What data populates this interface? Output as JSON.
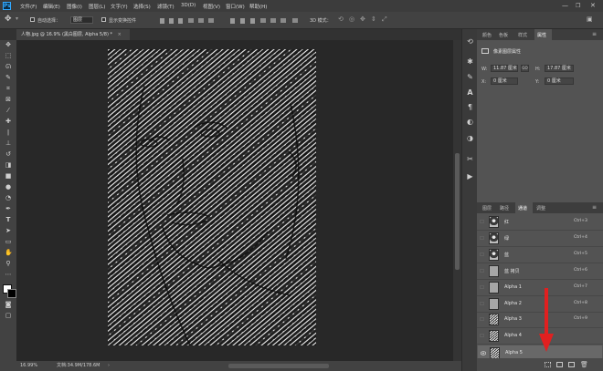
{
  "app": {
    "logo": "Ps",
    "accent": "#31a8ff"
  },
  "menu": [
    "文件(F)",
    "编辑(E)",
    "图像(I)",
    "图层(L)",
    "文字(Y)",
    "选择(S)",
    "滤镜(T)",
    "3D(D)",
    "视图(V)",
    "窗口(W)",
    "帮助(H)"
  ],
  "options_bar": {
    "auto_select_label": "自动选择：",
    "auto_select_value": "图层",
    "show_transform_label": "显示变换控件",
    "mode_3d_label": "3D 模式："
  },
  "document_tab": {
    "title": "人物.jpg @ 16.9% (黑白图层, Alpha 5/8) *",
    "close": "×"
  },
  "status_bar": {
    "zoom": "16.99%",
    "doc_info": "文档:34.9M/178.6M"
  },
  "properties_panel": {
    "tabs": [
      "颜色",
      "色板",
      "样式",
      "属性"
    ],
    "active_tab": "属性",
    "section_title": "像素图层属性",
    "w_label": "W:",
    "w_value": "11.87 厘米",
    "link_label": "GO",
    "h_label": "H:",
    "h_value": "17.87 厘米",
    "x_label": "X:",
    "x_value": "0 厘米",
    "y_label": "Y:",
    "y_value": "0 厘米"
  },
  "channels_panel": {
    "tabs": [
      "图层",
      "路径",
      "通道",
      "调整"
    ],
    "active_tab": "通道",
    "channels": [
      {
        "name": "红",
        "shortcut": "Ctrl+3",
        "visible": false,
        "selected": false,
        "thumb": "portrait"
      },
      {
        "name": "绿",
        "shortcut": "Ctrl+4",
        "visible": false,
        "selected": false,
        "thumb": "portrait"
      },
      {
        "name": "蓝",
        "shortcut": "Ctrl+5",
        "visible": false,
        "selected": false,
        "thumb": "portrait"
      },
      {
        "name": "蓝 拷贝",
        "shortcut": "Ctrl+6",
        "visible": false,
        "selected": false,
        "thumb": "gray"
      },
      {
        "name": "Alpha 1",
        "shortcut": "Ctrl+7",
        "visible": false,
        "selected": false,
        "thumb": "gray"
      },
      {
        "name": "Alpha 2",
        "shortcut": "Ctrl+8",
        "visible": false,
        "selected": false,
        "thumb": "gray"
      },
      {
        "name": "Alpha 3",
        "shortcut": "Ctrl+9",
        "visible": false,
        "selected": false,
        "thumb": "texture"
      },
      {
        "name": "Alpha 4",
        "shortcut": "",
        "visible": false,
        "selected": false,
        "thumb": "texture"
      },
      {
        "name": "Alpha 5",
        "shortcut": "",
        "visible": true,
        "selected": true,
        "thumb": "texture"
      }
    ]
  },
  "annotation_arrow_color": "#e02020"
}
